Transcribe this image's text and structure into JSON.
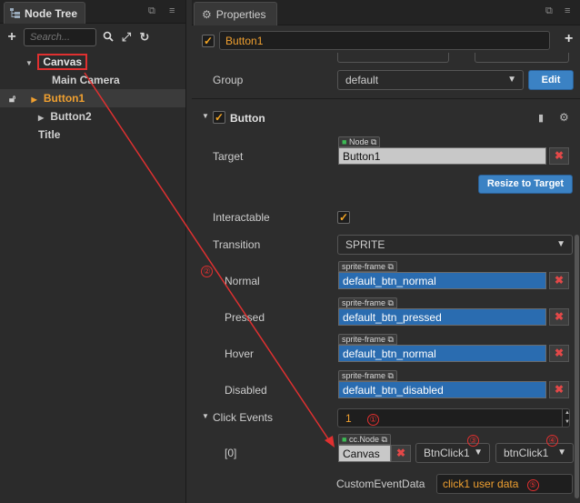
{
  "node_tree": {
    "title": "Node Tree",
    "search_placeholder": "Search...",
    "items": [
      {
        "label": "Canvas",
        "expanded": true
      },
      {
        "label": "Main Camera"
      },
      {
        "label": "Button1",
        "selected": true
      },
      {
        "label": "Button2"
      },
      {
        "label": "Title"
      }
    ]
  },
  "properties": {
    "title": "Properties",
    "node_name": "Button1",
    "group_label": "Group",
    "group_value": "default",
    "edit_button": "Edit",
    "component": {
      "title": "Button",
      "target_label": "Target",
      "target_tag": "Node",
      "target_value": "Button1",
      "resize_button": "Resize to Target",
      "interactable_label": "Interactable",
      "transition_label": "Transition",
      "transition_value": "SPRITE",
      "sprite_tag": "sprite-frame",
      "normal_label": "Normal",
      "normal_value": "default_btn_normal",
      "pressed_label": "Pressed",
      "pressed_value": "default_btn_pressed",
      "hover_label": "Hover",
      "hover_value": "default_btn_normal",
      "disabled_label": "Disabled",
      "disabled_value": "default_btn_disabled",
      "click_events_label": "Click Events",
      "click_events_count": "1",
      "event_index": "[0]",
      "event_target_tag": "cc.Node",
      "event_target_value": "Canvas",
      "component_value": "BtnClick1",
      "handler_value": "btnClick1",
      "custom_data_label": "CustomEventData",
      "custom_data_value": "click1 user data"
    }
  },
  "annotations": [
    "①",
    "②",
    "③",
    "④",
    "⑤"
  ],
  "colors": {
    "accent": "#f5a623",
    "annotation": "#e03030",
    "selected_text": "#f0a030",
    "link_blue": "#2a6cb0"
  }
}
